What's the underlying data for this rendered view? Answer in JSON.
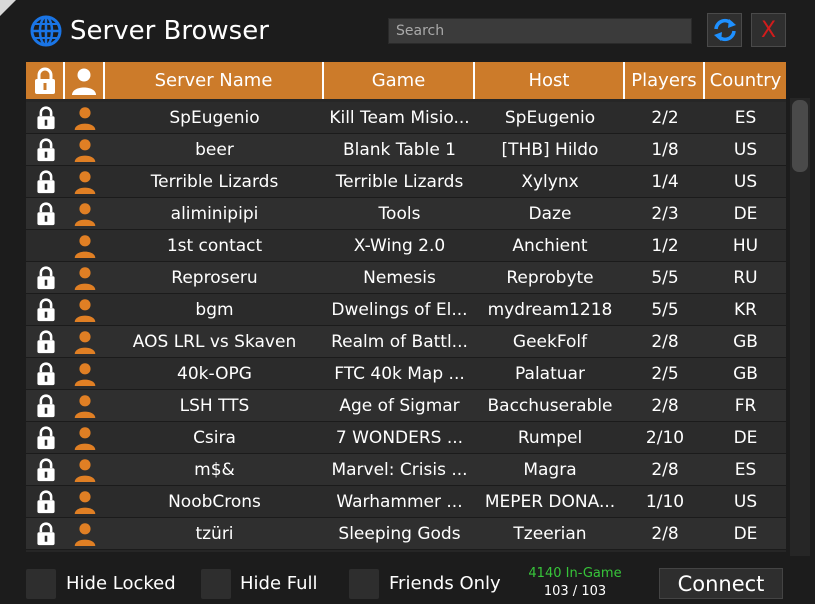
{
  "window": {
    "title": "Server Browser"
  },
  "search": {
    "placeholder": "Search",
    "value": ""
  },
  "buttons": {
    "refresh_icon": "refresh-icon",
    "close_label": "X",
    "connect_label": "Connect"
  },
  "colors": {
    "accent": "#cc7b2a",
    "close": "#d11c1c",
    "ingame": "#37c53a",
    "refresh": "#1e90ff"
  },
  "table": {
    "headers": {
      "lock_icon": "lock-icon",
      "user_icon": "user-icon",
      "server": "Server Name",
      "game": "Game",
      "host": "Host",
      "players": "Players",
      "country": "Country"
    },
    "rows": [
      {
        "locked": true,
        "server": "SpEugenio",
        "game": "Kill Team Misio...",
        "host": "SpEugenio",
        "players": "2/2",
        "country": "ES"
      },
      {
        "locked": true,
        "server": "beer",
        "game": "Blank Table 1",
        "host": "[THB]  Hildo",
        "players": "1/8",
        "country": "US"
      },
      {
        "locked": true,
        "server": "Terrible Lizards",
        "game": "Terrible Lizards",
        "host": "Xylynx",
        "players": "1/4",
        "country": "US"
      },
      {
        "locked": true,
        "server": "aliminipipi",
        "game": "Tools",
        "host": "Daze",
        "players": "2/3",
        "country": "DE"
      },
      {
        "locked": false,
        "server": "1st contact",
        "game": "X-Wing 2.0",
        "host": "Anchient",
        "players": "1/2",
        "country": "HU"
      },
      {
        "locked": true,
        "server": "Reproseru",
        "game": "Nemesis",
        "host": "Reprobyte",
        "players": "5/5",
        "country": "RU"
      },
      {
        "locked": true,
        "server": "bgm",
        "game": "Dwelings of El...",
        "host": "mydream1218",
        "players": "5/5",
        "country": "KR"
      },
      {
        "locked": true,
        "server": "AOS LRL vs Skaven",
        "game": "Realm of Battl...",
        "host": "GeekFolf",
        "players": "2/8",
        "country": "GB"
      },
      {
        "locked": true,
        "server": "40k-OPG",
        "game": "FTC 40k Map ...",
        "host": "Palatuar",
        "players": "2/5",
        "country": "GB"
      },
      {
        "locked": true,
        "server": "LSH TTS",
        "game": "Age of Sigmar",
        "host": "Bacchuserable",
        "players": "2/8",
        "country": "FR"
      },
      {
        "locked": true,
        "server": "Csira",
        "game": "7 WONDERS ...",
        "host": "Rumpel",
        "players": "2/10",
        "country": "DE"
      },
      {
        "locked": true,
        "server": "m$&",
        "game": "Marvel: Crisis ...",
        "host": "Magra",
        "players": "2/8",
        "country": "ES"
      },
      {
        "locked": true,
        "server": "NoobCrons",
        "game": "Warhammer ...",
        "host": "MEPER DONA...",
        "players": "1/10",
        "country": "US"
      },
      {
        "locked": true,
        "server": "tzüri",
        "game": "Sleeping Gods",
        "host": "Tzeerian",
        "players": "2/8",
        "country": "DE"
      }
    ]
  },
  "filters": {
    "hide_locked": "Hide Locked",
    "hide_full": "Hide Full",
    "friends_only": "Friends Only"
  },
  "status": {
    "ingame": "4140 In-Game",
    "count": "103 / 103"
  }
}
